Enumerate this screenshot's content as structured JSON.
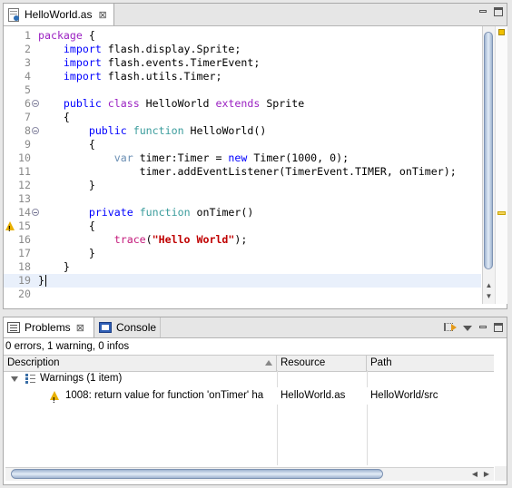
{
  "editor": {
    "tab_label": "HelloWorld.as",
    "close_glyph": "⊠",
    "lines": [
      {
        "n": "1",
        "tokens": [
          {
            "t": "package",
            "c": "kwp"
          },
          {
            "t": " {",
            "c": ""
          }
        ]
      },
      {
        "n": "2",
        "tokens": [
          {
            "t": "    ",
            "c": ""
          },
          {
            "t": "import",
            "c": "kw"
          },
          {
            "t": " flash.display.Sprite;",
            "c": ""
          }
        ]
      },
      {
        "n": "3",
        "tokens": [
          {
            "t": "    ",
            "c": ""
          },
          {
            "t": "import",
            "c": "kw"
          },
          {
            "t": " flash.events.TimerEvent;",
            "c": ""
          }
        ]
      },
      {
        "n": "4",
        "tokens": [
          {
            "t": "    ",
            "c": ""
          },
          {
            "t": "import",
            "c": "kw"
          },
          {
            "t": " flash.utils.Timer;",
            "c": ""
          }
        ]
      },
      {
        "n": "5",
        "tokens": []
      },
      {
        "n": "6",
        "fold": true,
        "tokens": [
          {
            "t": "    ",
            "c": ""
          },
          {
            "t": "public",
            "c": "kw"
          },
          {
            "t": " ",
            "c": ""
          },
          {
            "t": "class",
            "c": "kwp"
          },
          {
            "t": " HelloWorld ",
            "c": ""
          },
          {
            "t": "extends",
            "c": "kwp"
          },
          {
            "t": " Sprite",
            "c": ""
          }
        ]
      },
      {
        "n": "7",
        "tokens": [
          {
            "t": "    {",
            "c": ""
          }
        ]
      },
      {
        "n": "8",
        "fold": true,
        "tokens": [
          {
            "t": "        ",
            "c": ""
          },
          {
            "t": "public",
            "c": "kw"
          },
          {
            "t": " ",
            "c": ""
          },
          {
            "t": "function",
            "c": "kwg"
          },
          {
            "t": " HelloWorld()",
            "c": ""
          }
        ]
      },
      {
        "n": "9",
        "tokens": [
          {
            "t": "        {",
            "c": ""
          }
        ]
      },
      {
        "n": "10",
        "tokens": [
          {
            "t": "            ",
            "c": ""
          },
          {
            "t": "var",
            "c": "kwt"
          },
          {
            "t": " timer:Timer = ",
            "c": ""
          },
          {
            "t": "new",
            "c": "kw"
          },
          {
            "t": " Timer(1000, 0);",
            "c": ""
          }
        ]
      },
      {
        "n": "11",
        "tokens": [
          {
            "t": "                timer.addEventListener(TimerEvent.TIMER, onTimer);",
            "c": ""
          }
        ]
      },
      {
        "n": "12",
        "tokens": [
          {
            "t": "        }",
            "c": ""
          }
        ]
      },
      {
        "n": "13",
        "tokens": []
      },
      {
        "n": "14",
        "fold": true,
        "tokens": [
          {
            "t": "        ",
            "c": ""
          },
          {
            "t": "private",
            "c": "kw"
          },
          {
            "t": " ",
            "c": ""
          },
          {
            "t": "function",
            "c": "kwg"
          },
          {
            "t": " onTimer()",
            "c": ""
          }
        ]
      },
      {
        "n": "15",
        "warn": true,
        "tokens": [
          {
            "t": "        {",
            "c": ""
          }
        ]
      },
      {
        "n": "16",
        "tokens": [
          {
            "t": "            ",
            "c": ""
          },
          {
            "t": "trace",
            "c": "trace"
          },
          {
            "t": "(",
            "c": ""
          },
          {
            "t": "\"Hello World\"",
            "c": "str"
          },
          {
            "t": ");",
            "c": ""
          }
        ]
      },
      {
        "n": "17",
        "tokens": [
          {
            "t": "        }",
            "c": ""
          }
        ]
      },
      {
        "n": "18",
        "tokens": [
          {
            "t": "    }",
            "c": ""
          }
        ]
      },
      {
        "n": "19",
        "current": true,
        "caret": true,
        "tokens": [
          {
            "t": "}",
            "c": ""
          }
        ]
      },
      {
        "n": "20",
        "tokens": []
      }
    ]
  },
  "problems": {
    "tabs": [
      {
        "label": "Problems",
        "close_glyph": "⊠"
      },
      {
        "label": "Console"
      }
    ],
    "summary": "0 errors, 1 warning, 0 infos",
    "columns": [
      "Description",
      "Resource",
      "Path"
    ],
    "group_label": "Warnings (1 item)",
    "items": [
      {
        "description": "1008: return value for function 'onTimer' ha",
        "resource": "HelloWorld.as",
        "path": "HelloWorld/src"
      }
    ]
  },
  "icons": {
    "editor_tab": "actionscript-file-icon",
    "problems_tab": "problems-icon",
    "console_tab": "console-icon",
    "warning": "warning-icon",
    "filter": "filter-icon",
    "view_menu": "view-menu-icon"
  },
  "colors": {
    "keyword_blue": "#0000ff",
    "keyword_purple": "#9b22c2",
    "function_teal": "#3a9c9c",
    "string_red": "#c00000",
    "warning_yellow": "#e8b000",
    "current_line": "#e9f0fb"
  }
}
